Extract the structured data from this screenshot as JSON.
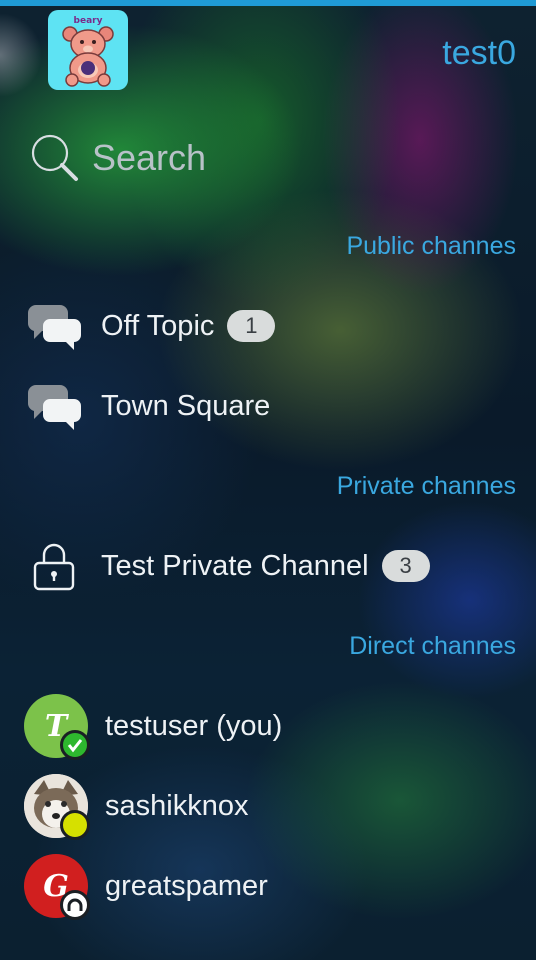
{
  "header": {
    "username": "test0",
    "avatar_icon": "teddy-bear-avatar"
  },
  "search": {
    "placeholder": "Search"
  },
  "public_section": {
    "label": "Public channes",
    "channels": [
      {
        "name": "Off Topic",
        "unread": "1",
        "icon": "chat-bubbles-icon"
      },
      {
        "name": "Town Square",
        "unread": "",
        "icon": "chat-bubbles-icon"
      }
    ]
  },
  "private_section": {
    "label": "Private channes",
    "channels": [
      {
        "name": "Test Private Channel",
        "unread": "3",
        "icon": "lock-icon"
      }
    ]
  },
  "direct_section": {
    "label": "Direct channes",
    "users": [
      {
        "name": "testuser (you)",
        "initial": "T",
        "avatar_color": "#7cc24a",
        "status": "online",
        "status_color": "#2eb82e"
      },
      {
        "name": "sashikknox",
        "initial": "",
        "avatar_color": "#d8d4cf",
        "status": "away",
        "status_color": "#d6e000"
      },
      {
        "name": "greatspamer",
        "initial": "G",
        "avatar_color": "#d11f1f",
        "status": "offline",
        "status_color": "#ffffff"
      }
    ]
  },
  "colors": {
    "accent": "#3aa8e0",
    "badge_bg": "#d9dcdc"
  }
}
